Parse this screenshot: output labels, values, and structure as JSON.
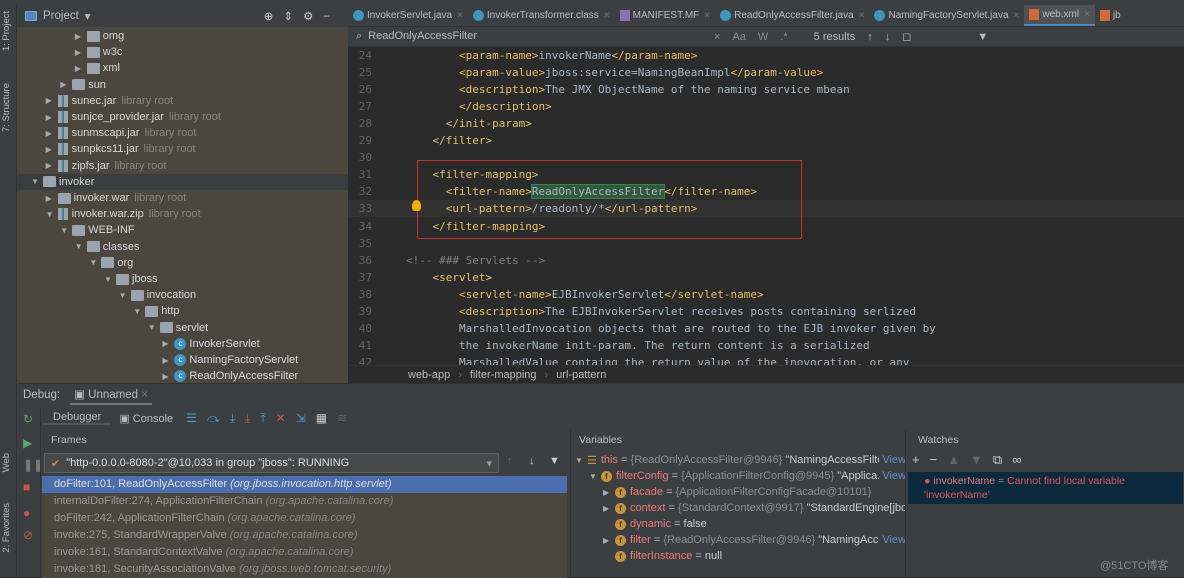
{
  "left_strip": {
    "project": "1: Project",
    "structure": "7: Structure",
    "web": "Web",
    "favorites": "2: Favorites"
  },
  "project": {
    "title": "Project",
    "tree": [
      {
        "depth": 3,
        "name": "omg",
        "icon": "folder",
        "arrow": "right"
      },
      {
        "depth": 3,
        "name": "w3c",
        "icon": "folder",
        "arrow": "right"
      },
      {
        "depth": 3,
        "name": "xml",
        "icon": "folder",
        "arrow": "right"
      },
      {
        "depth": 2,
        "name": "sun",
        "icon": "folder",
        "arrow": "right"
      },
      {
        "depth": 1,
        "name": "sunec.jar",
        "suffix": "library root",
        "icon": "jar",
        "arrow": "right"
      },
      {
        "depth": 1,
        "name": "sunjce_provider.jar",
        "suffix": "library root",
        "icon": "jar",
        "arrow": "right"
      },
      {
        "depth": 1,
        "name": "sunmscapi.jar",
        "suffix": "library root",
        "icon": "jar",
        "arrow": "right"
      },
      {
        "depth": 1,
        "name": "sunpkcs11.jar",
        "suffix": "library root",
        "icon": "jar",
        "arrow": "right"
      },
      {
        "depth": 1,
        "name": "zipfs.jar",
        "suffix": "library root",
        "icon": "jar",
        "arrow": "right"
      },
      {
        "depth": 0,
        "name": "invoker",
        "icon": "module",
        "arrow": "down",
        "selected": true
      },
      {
        "depth": 1,
        "name": "invoker.war",
        "suffix": "library root",
        "icon": "folder",
        "arrow": "right"
      },
      {
        "depth": 1,
        "name": "invoker.war.zip",
        "suffix": "library root",
        "icon": "jar",
        "arrow": "down"
      },
      {
        "depth": 2,
        "name": "WEB-INF",
        "icon": "folder",
        "arrow": "down"
      },
      {
        "depth": 3,
        "name": "classes",
        "icon": "folder",
        "arrow": "down"
      },
      {
        "depth": 4,
        "name": "org",
        "icon": "folder",
        "arrow": "down"
      },
      {
        "depth": 5,
        "name": "jboss",
        "icon": "folder",
        "arrow": "down"
      },
      {
        "depth": 6,
        "name": "invocation",
        "icon": "folder",
        "arrow": "down"
      },
      {
        "depth": 7,
        "name": "http",
        "icon": "folder",
        "arrow": "down"
      },
      {
        "depth": 8,
        "name": "servlet",
        "icon": "folder",
        "arrow": "down"
      },
      {
        "depth": 9,
        "name": "InvokerServlet",
        "icon": "class",
        "arrow": "right"
      },
      {
        "depth": 9,
        "name": "NamingFactoryServlet",
        "icon": "class",
        "arrow": "right"
      },
      {
        "depth": 9,
        "name": "ReadOnlyAccessFilter",
        "icon": "class",
        "arrow": "right"
      }
    ]
  },
  "tabs": [
    {
      "label": "InvokerServlet.java",
      "icon": "class"
    },
    {
      "label": "InvokerTransformer.class",
      "icon": "class"
    },
    {
      "label": "MANIFEST.MF",
      "icon": "manifest"
    },
    {
      "label": "ReadOnlyAccessFilter.java",
      "icon": "class"
    },
    {
      "label": "NamingFactoryServlet.java",
      "icon": "class"
    },
    {
      "label": "web.xml",
      "icon": "xml",
      "active": true
    },
    {
      "label": "jb",
      "icon": "xml"
    }
  ],
  "search": {
    "query": "ReadOnlyAccessFilter",
    "results": "5 results",
    "match_case": "Aa",
    "words": "W",
    "regex": ".*"
  },
  "editor": {
    "current_line": 33,
    "lines": [
      {
        "n": 24,
        "ind": "        ",
        "seg": [
          [
            "tg",
            "<param-name>"
          ],
          [
            "tx",
            "invokerName"
          ],
          [
            "tg",
            "</param-name>"
          ]
        ]
      },
      {
        "n": 25,
        "ind": "        ",
        "seg": [
          [
            "tg",
            "<param-value>"
          ],
          [
            "tx",
            "jboss:service=NamingBeanImpl"
          ],
          [
            "tg",
            "</param-value>"
          ]
        ]
      },
      {
        "n": 26,
        "ind": "        ",
        "seg": [
          [
            "tg",
            "<description>"
          ],
          [
            "tx",
            "The JMX ObjectName of the naming service mbean"
          ]
        ]
      },
      {
        "n": 27,
        "ind": "        ",
        "seg": [
          [
            "tg",
            "</description>"
          ]
        ]
      },
      {
        "n": 28,
        "ind": "      ",
        "seg": [
          [
            "tg",
            "</init-param>"
          ]
        ]
      },
      {
        "n": 29,
        "ind": "    ",
        "seg": [
          [
            "tg",
            "</filter>"
          ]
        ]
      },
      {
        "n": 30,
        "ind": "",
        "seg": []
      },
      {
        "n": 31,
        "ind": "    ",
        "seg": [
          [
            "tg",
            "<filter-mapping>"
          ]
        ]
      },
      {
        "n": 32,
        "ind": "      ",
        "seg": [
          [
            "tg",
            "<filter-name>"
          ],
          [
            "hl",
            "ReadOnlyAccessFilter"
          ],
          [
            "tg",
            "</filter-name>"
          ]
        ]
      },
      {
        "n": 33,
        "ind": "      ",
        "seg": [
          [
            "tg",
            "<url-pattern>"
          ],
          [
            "tx",
            "/readonly/*"
          ],
          [
            "tg",
            "</url-pattern>"
          ]
        ]
      },
      {
        "n": 34,
        "ind": "    ",
        "seg": [
          [
            "tg",
            "</filter-mapping>"
          ]
        ]
      },
      {
        "n": 35,
        "ind": "",
        "seg": []
      },
      {
        "n": 36,
        "ind": "",
        "seg": [
          [
            "cm",
            "<!-- ### Servlets -->"
          ]
        ]
      },
      {
        "n": 37,
        "ind": "    ",
        "seg": [
          [
            "tg",
            "<servlet>"
          ]
        ]
      },
      {
        "n": 38,
        "ind": "        ",
        "seg": [
          [
            "tg",
            "<servlet-name>"
          ],
          [
            "tx",
            "EJBInvokerServlet"
          ],
          [
            "tg",
            "</servlet-name>"
          ]
        ]
      },
      {
        "n": 39,
        "ind": "        ",
        "seg": [
          [
            "tg",
            "<description>"
          ],
          [
            "tx",
            "The EJBInvokerServlet receives posts containing serlized"
          ]
        ]
      },
      {
        "n": 40,
        "ind": "        ",
        "seg": [
          [
            "tx",
            "MarshalledInvocation objects that are routed to the EJB invoker given by"
          ]
        ]
      },
      {
        "n": 41,
        "ind": "        ",
        "seg": [
          [
            "tx",
            "the invokerName init-param. The return content is a serialized"
          ]
        ]
      },
      {
        "n": 42,
        "ind": "        ",
        "seg": [
          [
            "tx",
            "MarshalledValue containg the return value of the inovocation, or any"
          ]
        ]
      }
    ]
  },
  "breadcrumb": [
    "web-app",
    "filter-mapping",
    "url-pattern"
  ],
  "debug": {
    "label": "Debug:",
    "session": "Unnamed",
    "debugger_tab": "Debugger",
    "console_tab": "Console",
    "frames_title": "Frames",
    "thread": "\"http-0.0.0.0-8080-2\"@10,033 in group \"jboss\": RUNNING",
    "frames": [
      {
        "method": "doFilter:101, ReadOnlyAccessFilter",
        "pkg": "(org.jboss.invocation.http.servlet)",
        "selected": true
      },
      {
        "method": "internalDoFilter:274, ApplicationFilterChain",
        "pkg": "(org.apache.catalina.core)"
      },
      {
        "method": "doFilter:242, ApplicationFilterChain",
        "pkg": "(org.apache.catalina.core)"
      },
      {
        "method": "invoke:275, StandardWrapperValve",
        "pkg": "(org.apache.catalina.core)"
      },
      {
        "method": "invoke:161, StandardContextValve",
        "pkg": "(org.apache.catalina.core)"
      },
      {
        "method": "invoke:181, SecurityAssociationValve",
        "pkg": "(org.jboss.web.tomcat.security)"
      }
    ],
    "variables_title": "Variables",
    "variables": [
      {
        "depth": 0,
        "arrow": "down",
        "icon": "stack",
        "name": "this",
        "value": "{ReadOnlyAccessFilter@9946}",
        "str": "\"NamingAccessFilter...",
        "view": "View"
      },
      {
        "depth": 1,
        "arrow": "down",
        "icon": "field",
        "name": "filterConfig",
        "value": "{ApplicationFilterConfig@9945}",
        "str": "\"Applica...",
        "view": "View"
      },
      {
        "depth": 2,
        "arrow": "right",
        "icon": "field",
        "name": "facade",
        "value": "{ApplicationFilterConfigFacade@10101}",
        "str": ""
      },
      {
        "depth": 2,
        "arrow": "right",
        "icon": "field",
        "name": "context",
        "value": "{StandardContext@9917}",
        "str": "\"StandardEngine[jboss"
      },
      {
        "depth": 2,
        "arrow": "",
        "icon": "field",
        "name": "dynamic",
        "value": "",
        "str": "false"
      },
      {
        "depth": 2,
        "arrow": "right",
        "icon": "field",
        "name": "filter",
        "value": "{ReadOnlyAccessFilter@9946}",
        "str": "\"NamingAcce...",
        "view": "View"
      },
      {
        "depth": 2,
        "arrow": "",
        "icon": "field",
        "name": "filterInstance",
        "value": "",
        "str": "null"
      }
    ],
    "watches_title": "Watches",
    "watches": [
      {
        "name": "invokerName",
        "error": "Cannot find local variable 'invokerName'"
      }
    ]
  },
  "watermark": "@51CTO博客"
}
